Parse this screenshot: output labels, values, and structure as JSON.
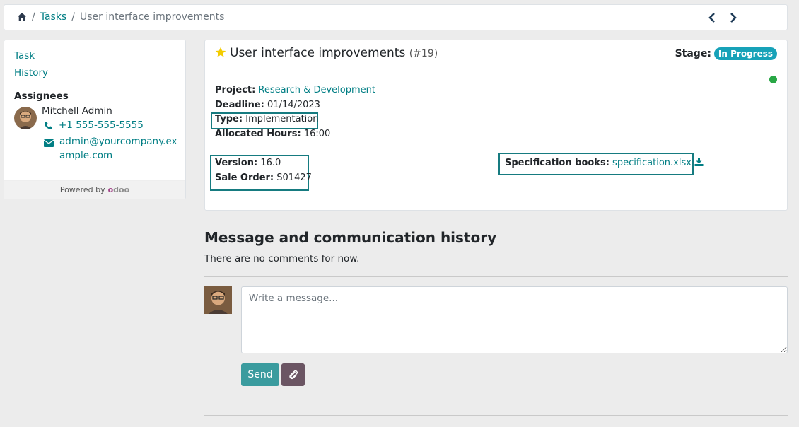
{
  "breadcrumb": {
    "home_icon": "home-icon",
    "sep1": "/",
    "tasks": "Tasks",
    "sep2": "/",
    "current": "User interface improvements"
  },
  "pager": {
    "prev_icon": "chevron-left-icon",
    "next_icon": "chevron-right-icon"
  },
  "sidebar": {
    "nav": [
      "Task",
      "History"
    ],
    "assignees_label": "Assignees",
    "assignee": {
      "name": "Mitchell Admin",
      "phone": "+1 555-555-5555",
      "email": "admin@yourcompany.example.com"
    },
    "powered_by": "Powered by",
    "powered_brand": "odoo"
  },
  "task": {
    "title": "User interface improvements",
    "number": "(#19)",
    "stage_label": "Stage:",
    "stage_value": "In Progress",
    "fields": {
      "project_label": "Project:",
      "project_value": "Research & Development",
      "deadline_label": "Deadline:",
      "deadline_value": "01/14/2023",
      "type_label": "Type:",
      "type_value": "Implementation",
      "hours_label": "Allocated Hours:",
      "hours_value": "16:00",
      "version_label": "Version:",
      "version_value": "16.0",
      "sale_label": "Sale Order:",
      "sale_value": "S01427",
      "spec_label": "Specification books:",
      "spec_value": "specification.xlsx"
    }
  },
  "chatter": {
    "title": "Message and communication history",
    "empty": "There are no comments for now.",
    "placeholder": "Write a message...",
    "send": "Send"
  },
  "colors": {
    "accent": "#017e84",
    "badge": "#17a2b8",
    "send": "#3a9b9e",
    "attach": "#6b5563",
    "highlight": "#167b80",
    "status": "#28a745"
  }
}
